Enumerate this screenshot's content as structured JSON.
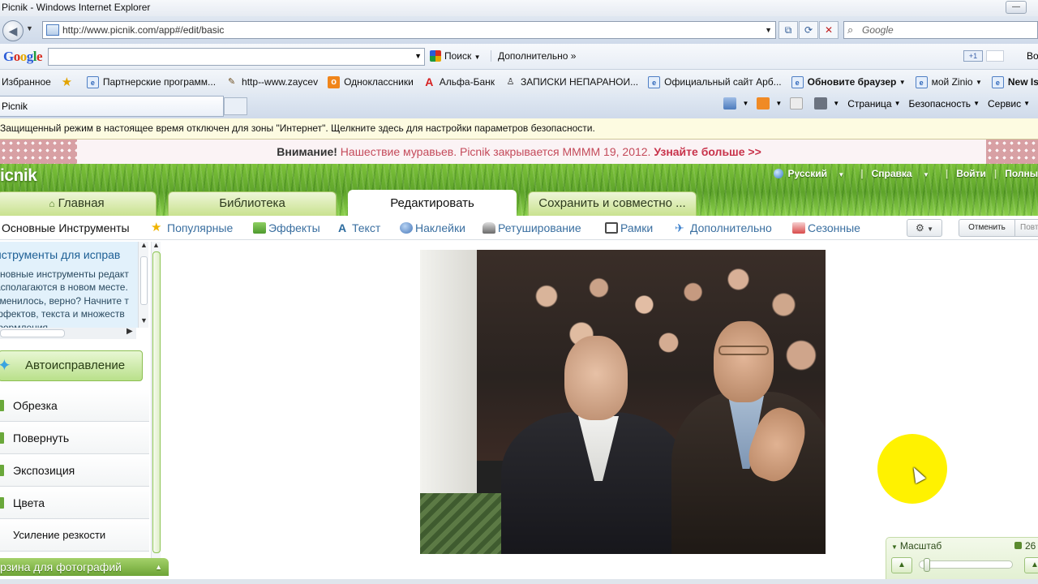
{
  "window": {
    "title": "Picnik - Windows Internet Explorer"
  },
  "address": {
    "url": "http://www.picnik.com/app#/edit/basic",
    "search_placeholder": "Google"
  },
  "google_toolbar": {
    "logo": [
      "G",
      "o",
      "o",
      "g",
      "l",
      "e"
    ],
    "search_label": "Поиск",
    "more_label": "Дополнительно",
    "plus_label": "+1",
    "user_label": "Во"
  },
  "favorites": {
    "label": "Избранное",
    "items": [
      {
        "label": "Партнерские программ...",
        "icon": "ie"
      },
      {
        "label": "http--www.zaycev",
        "icon": "zap"
      },
      {
        "label": "Одноклассники",
        "icon": "ok"
      },
      {
        "label": "Альфа-Банк",
        "icon": "alfa"
      },
      {
        "label": "ЗАПИСКИ НЕПАРАНОИ...",
        "icon": "user"
      },
      {
        "label": "Официальный сайт Арб...",
        "icon": "ie"
      },
      {
        "label": "Обновите браузер",
        "icon": "ie",
        "bold": true,
        "dropdown": true
      },
      {
        "label": "мой Zinio",
        "icon": "ie",
        "dropdown": true
      },
      {
        "label": "New Issu",
        "icon": "ie",
        "bold": true
      }
    ]
  },
  "tabs": {
    "active_tab": "Picnik"
  },
  "command_bar": {
    "page_label": "Страница",
    "safety_label": "Безопасность",
    "service_label": "Сервис"
  },
  "infobar": {
    "text": "Защищенный режим в настоящее время отключен для зоны \"Интернет\".  Щелкните здесь для настройки параметров безопасности."
  },
  "notice": {
    "prefix": "Внимание!",
    "message": "Нашествие муравьев. Picnik закрывается ММММ 19, 2012.",
    "link": "Узнайте больше >>"
  },
  "picnik": {
    "logo": "icnik",
    "top_menu": {
      "language": "Русский",
      "help": "Справка",
      "login": "Войти",
      "full": "Полны"
    },
    "main_tabs": [
      {
        "label": "Главная"
      },
      {
        "label": "Библиотека"
      },
      {
        "label": "Редактировать",
        "active": true
      },
      {
        "label": "Сохранить и совместно ..."
      }
    ],
    "tool_tabs": [
      {
        "label": "Основные Инструменты",
        "icon": "none"
      },
      {
        "label": "Популярные",
        "icon": "star"
      },
      {
        "label": "Эффекты",
        "icon": "fx"
      },
      {
        "label": "Текст",
        "icon": "txt"
      },
      {
        "label": "Наклейки",
        "icon": "stick"
      },
      {
        "label": "Ретуширование",
        "icon": "ret"
      },
      {
        "label": "Рамки",
        "icon": "frm"
      },
      {
        "label": "Дополнительно",
        "icon": "more"
      },
      {
        "label": "Сезонные",
        "icon": "seas"
      }
    ],
    "undo_label": "Отменить",
    "redo_label": "Повт",
    "info_panel": {
      "title": "нструменты для исправ",
      "lines": [
        "сновные инструменты редакт",
        "асполагаются в новом месте.",
        "зменилось, верно? Начните т",
        "ффектов, текста и множеств",
        "формления"
      ]
    },
    "auto_fix_label": "Автоисправление",
    "tools": [
      {
        "label": "Обрезка"
      },
      {
        "label": "Повернуть"
      },
      {
        "label": "Экспозиция"
      },
      {
        "label": "Цвета"
      },
      {
        "label": "Усиление резкости"
      }
    ],
    "basket_label": "рзина для фотографий",
    "zoom": {
      "label": "Масштаб",
      "percent": "26",
      "slider_fraction": 0.05
    }
  }
}
